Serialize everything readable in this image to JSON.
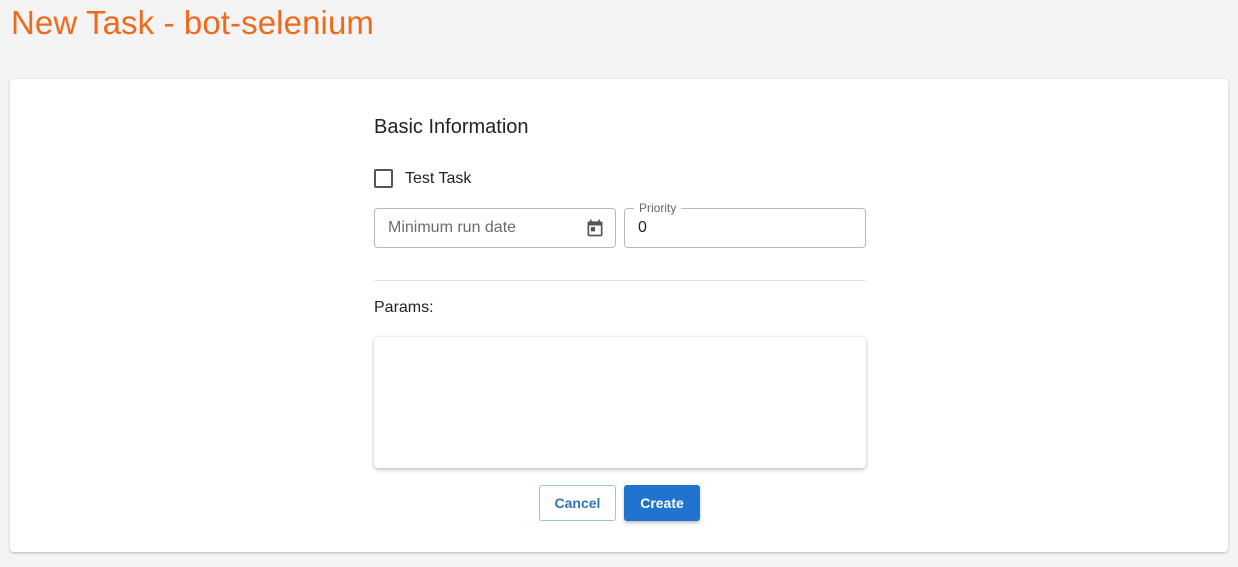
{
  "page": {
    "title": "New Task - bot-selenium"
  },
  "form": {
    "section_title": "Basic Information",
    "test_task": {
      "label": "Test Task",
      "checked": false
    },
    "min_run_date": {
      "placeholder": "Minimum run date",
      "value": ""
    },
    "priority": {
      "label": "Priority",
      "value": "0"
    },
    "params": {
      "label": "Params:",
      "value": ""
    },
    "buttons": {
      "cancel": "Cancel",
      "create": "Create"
    }
  },
  "icons": {
    "calendar": "calendar-icon"
  },
  "colors": {
    "title": "#f06a1d",
    "primary": "#1f74d0",
    "background": "#f4f4f4"
  }
}
